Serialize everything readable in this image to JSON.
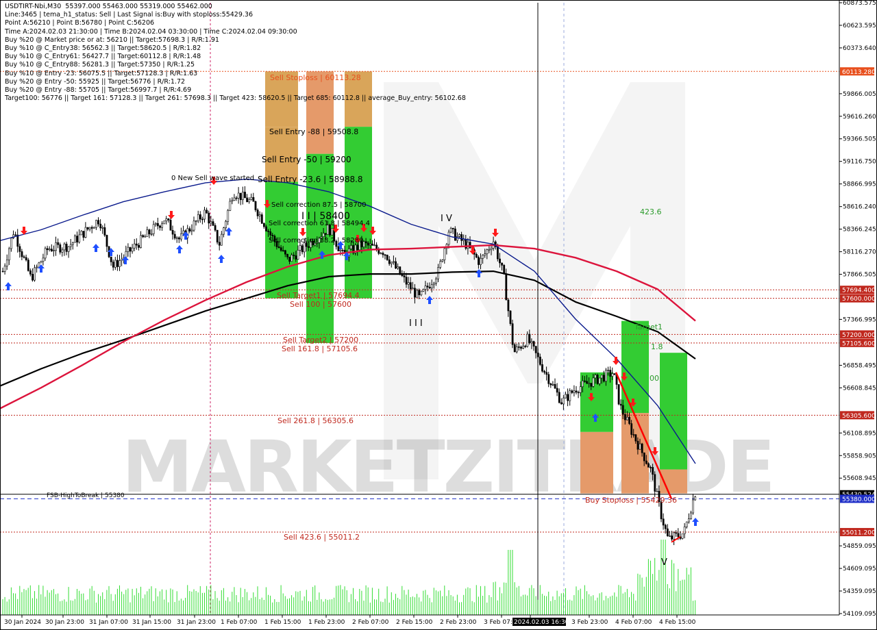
{
  "info_lines": [
    "USDTIRT-Nbi,M30  55397.000 55463.000 55319.000 55462.000",
    "Line:3465 | tema_h1_status: Sell | Last Signal is:Buy with stoploss:55429.36",
    "Point A:56210 | Point B:56780 | Point C:56206",
    "Time A:2024.02.03 21:30:00 | Time B:2024.02.04 03:30:00 | Time C:2024.02.04 09:30:00",
    "Buy %20 @ Market price or at: 56210 || Target:57698.3 | R/R:1.91",
    "Buy %10 @ C_Entry38: 56562.3 || Target:58620.5 | R/R:1.82",
    "Buy %10 @ C_Entry61: 56427.7 || Target:60112.8 | R/R:1.48",
    "Buy %10 @ C_Entry88: 56281.3 || Target:57350 | R/R:1.25",
    "Buy %10 @ Entry -23: 56075.5 || Target:57128.3 | R/R:1.63",
    "Buy %20 @ Entry -50: 55925 || Target:56776 | R/R:1.72",
    "Buy %20 @ Entry -88: 55705 || Target:56997.7 | R/R:4.69",
    "Target100: 56776 || Target 161: 57128.3 || Target 261: 57698.3 || Target 423: 58620.5 || Target 685: 60112.8 || average_Buy_entry: 56102.68"
  ],
  "watermark": "MARKETZITRADE",
  "colors": {
    "sell_line": "#c0281e",
    "hline": "#c0281e",
    "bid_line": "#1f2fc8",
    "ma_black": "#000000",
    "ma_red": "#dc143c",
    "ma_blue": "#0a1a8c",
    "zone_green": "#33cc33",
    "zone_orange": "#e8a05a",
    "zone_tan": "#d9a55a",
    "volume": "#33dd33",
    "candle": "#000000",
    "up_arrow": "#1f4fff",
    "down_arrow": "#ff1a1a"
  },
  "chart_data": {
    "type": "candlestick",
    "symbol": "USDTIRT-Nbi",
    "timeframe": "M30",
    "ylim": [
      54109.095,
      60873.575
    ],
    "y_ticks": [
      "60873.575",
      "60623.595",
      "60373.640",
      "60113.280",
      "59866.005",
      "59616.260",
      "59366.505",
      "59116.750",
      "58866.995",
      "58616.240",
      "58366.245",
      "58116.270",
      "57866.505",
      "57694.400",
      "57600.000",
      "57366.995",
      "57200.000",
      "57105.600",
      "56858.495",
      "56608.845",
      "56305.600",
      "56108.895",
      "55858.905",
      "55608.945",
      "55430.524",
      "55380.000",
      "55011.200",
      "54859.095",
      "54609.095",
      "54359.095",
      "54109.095"
    ],
    "x_ticks": [
      "30 Jan 2024",
      "30 Jan 23:00",
      "31 Jan 07:00",
      "31 Jan 15:00",
      "31 Jan 23:00",
      "1 Feb 07:00",
      "1 Feb 15:00",
      "1 Feb 23:00",
      "2 Feb 07:00",
      "2 Feb 15:00",
      "2 Feb 23:00",
      "3 Feb 07:00",
      "2024.02.03 16:30",
      "3 Feb 23:00",
      "4 Feb 07:00",
      "4 Feb 15:00"
    ],
    "price_labels": [
      {
        "value": 60113.28,
        "text": "60113.280",
        "color": "#e8501e"
      },
      {
        "value": 57694.4,
        "text": "57694.400",
        "color": "#c0281e"
      },
      {
        "value": 57600.0,
        "text": "57600.000",
        "color": "#c0281e"
      },
      {
        "value": 57200.0,
        "text": "57200.000",
        "color": "#c0281e"
      },
      {
        "value": 57105.6,
        "text": "57105.600",
        "color": "#c0281e"
      },
      {
        "value": 56305.6,
        "text": "56305.600",
        "color": "#c0281e"
      },
      {
        "value": 55430.524,
        "text": "55430.524",
        "color": "#000000"
      },
      {
        "value": 55380.0,
        "text": "55380.000",
        "color": "#1f2fc8"
      },
      {
        "value": 55011.2,
        "text": "55011.200",
        "color": "#c0281e"
      }
    ],
    "annotations": [
      {
        "text": "Sell Stoploss | 60113.28",
        "color": "#e8501e"
      },
      {
        "text": "Sell Entry -88 | 59508.8",
        "color": "#000"
      },
      {
        "text": "Sell Entry -50 | 59200",
        "color": "#000"
      },
      {
        "text": "Sell Entry -23.6 | 58988.8",
        "color": "#000"
      },
      {
        "text": "0 New Sell wave started",
        "color": "#000"
      },
      {
        "text": "Sell correction 87.5 | 58700",
        "color": "#000"
      },
      {
        "text": "Sell correction 61.8 | 58494.4",
        "color": "#000"
      },
      {
        "text": "Sell correction 38.2 | 58289",
        "color": "#000"
      },
      {
        "text": "I I | 58400",
        "color": "#000"
      },
      {
        "text": "I V",
        "color": "#000"
      },
      {
        "text": "I I I",
        "color": "#000"
      },
      {
        "text": "V",
        "color": "#000"
      },
      {
        "text": "Sell Target1 | 57694.4",
        "color": "#c0281e"
      },
      {
        "text": "Sell 100 | 57600",
        "color": "#c0281e"
      },
      {
        "text": "Sell Target2 | 57200",
        "color": "#c0281e"
      },
      {
        "text": "Sell 161.8 | 57105.6",
        "color": "#c0281e"
      },
      {
        "text": "Sell  261.8 | 56305.6",
        "color": "#c0281e"
      },
      {
        "text": "Sell  423.6 | 55011.2",
        "color": "#c0281e"
      },
      {
        "text": "FSB-HighToBreak | 55380",
        "color": "#000"
      },
      {
        "text": "Buy Stoploss | 55429.36",
        "color": "#c0281e"
      },
      {
        "text": "423.6",
        "color": "#2a9a2a"
      },
      {
        "text": "Target1",
        "color": "#2a9a2a"
      },
      {
        "text": "1.8",
        "color": "#2a9a2a"
      },
      {
        "text": "00",
        "color": "#2a9a2a"
      }
    ],
    "series": [
      {
        "name": "ma_black",
        "x": [
          0,
          60,
          120,
          180,
          240,
          300,
          360,
          420,
          480,
          540,
          600,
          660,
          720,
          780,
          840,
          900,
          960,
          1015
        ],
        "y": [
          56630,
          56820,
          56990,
          57140,
          57300,
          57460,
          57600,
          57740,
          57840,
          57870,
          57870,
          57890,
          57900,
          57800,
          57560,
          57400,
          57230,
          56930
        ]
      },
      {
        "name": "ma_red",
        "x": [
          0,
          60,
          120,
          180,
          240,
          300,
          360,
          420,
          480,
          540,
          600,
          660,
          720,
          780,
          840,
          900,
          960,
          1015
        ],
        "y": [
          56380,
          56610,
          56860,
          57120,
          57360,
          57580,
          57780,
          57950,
          58080,
          58140,
          58150,
          58170,
          58190,
          58150,
          58050,
          57900,
          57700,
          57350
        ]
      },
      {
        "name": "ma_blue",
        "x": [
          0,
          60,
          120,
          180,
          240,
          300,
          360,
          420,
          480,
          540,
          600,
          660,
          720,
          780,
          840,
          900,
          960,
          1015
        ],
        "y": [
          58240,
          58360,
          58520,
          58670,
          58780,
          58880,
          58920,
          58880,
          58780,
          58620,
          58420,
          58280,
          58200,
          57900,
          57370,
          56930,
          56410,
          55770
        ]
      }
    ]
  }
}
